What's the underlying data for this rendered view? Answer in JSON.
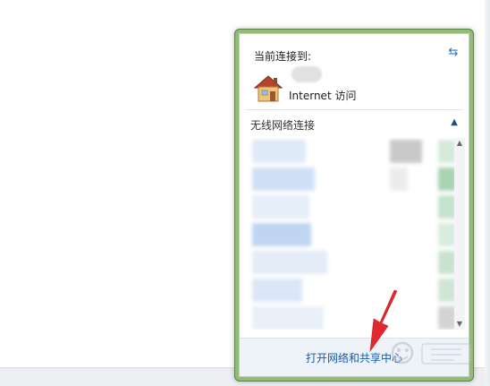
{
  "flyout": {
    "current_connection_label": "当前连接到:",
    "connection_access": "Internet 访问",
    "section_title": "无线网络连接",
    "footer_link": "打开网络和共享中心"
  },
  "icons": {
    "refresh": "refresh-icon",
    "home": "house-icon",
    "collapse": "chevron-up-icon"
  },
  "colors": {
    "border_accent": "#8fbd76",
    "link": "#1a5aa8",
    "arrow": "#e0292c"
  }
}
